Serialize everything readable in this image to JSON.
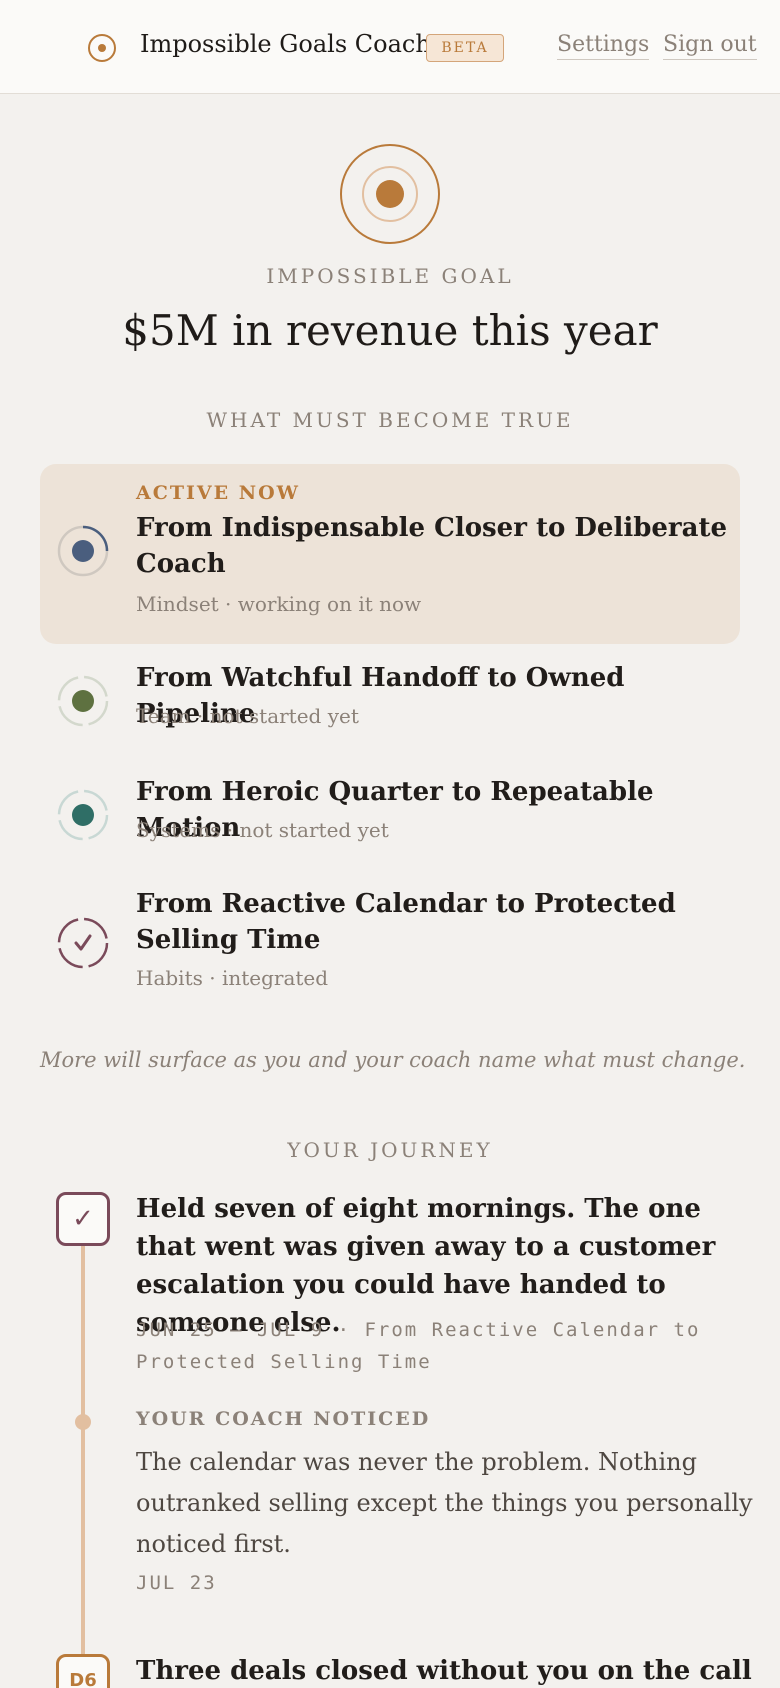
{
  "header": {
    "app_title": "Impossible Goals Coach",
    "badge": "BETA",
    "nav": {
      "settings": "Settings",
      "sign_out": "Sign out"
    }
  },
  "goal": {
    "kicker": "IMPOSSIBLE GOAL",
    "title": "$5M in revenue this year"
  },
  "truths": {
    "kicker": "WHAT MUST BECOME TRUE",
    "items": [
      {
        "label": "ACTIVE NOW",
        "title": "From Indispensable Closer to Deliberate Coach",
        "meta": "Mindset · working on it now",
        "color": "#4a5e7e",
        "status": "active"
      },
      {
        "title": "From Watchful Handoff to Owned Pipeline",
        "meta": "Team · not started yet",
        "color": "#5e7140",
        "status": "not-started"
      },
      {
        "title": "From Heroic Quarter to Repeatable Motion",
        "meta": "Systems · not started yet",
        "color": "#2f6e66",
        "status": "not-started"
      },
      {
        "title": "From Reactive Calendar to Protected Selling Time",
        "meta": "Habits · integrated",
        "color": "#7a4a5a",
        "status": "integrated"
      }
    ],
    "note": "More will surface as you and your coach name what must change."
  },
  "journey": {
    "kicker": "YOUR JOURNEY",
    "entries": [
      {
        "badge": "✓",
        "title": "Held seven of eight mornings. The one that went was given away to a customer escalation you could have handed to someone else.",
        "meta": "JUN 25 – JUL 9 · From Reactive Calendar to Protected Selling Time"
      },
      {
        "kicker": "YOUR COACH NOTICED",
        "text": "The calendar was never the problem. Nothing outranked selling except the things you personally noticed first.",
        "date": "JUL 23"
      },
      {
        "badge": "D6",
        "title": "Three deals closed without you on the call"
      }
    ]
  }
}
